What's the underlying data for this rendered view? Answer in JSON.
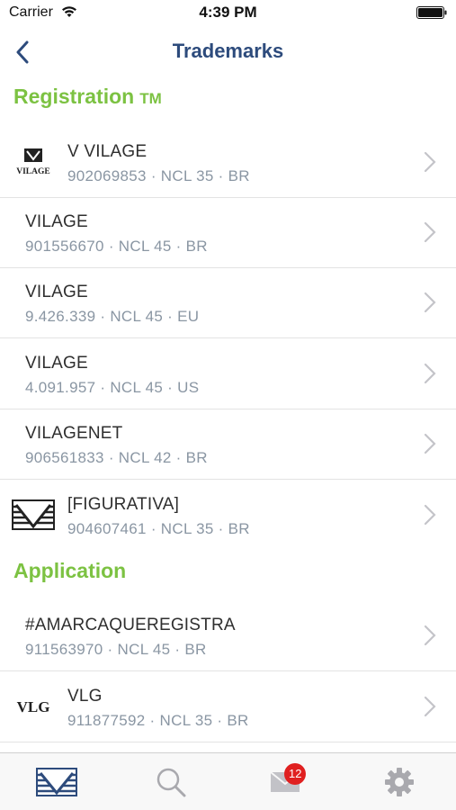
{
  "status_bar": {
    "carrier": "Carrier",
    "time": "4:39 PM"
  },
  "nav": {
    "title": "Trademarks"
  },
  "sections": {
    "registration": {
      "label": "Registration",
      "tm": "TM"
    },
    "application": {
      "label": "Application"
    }
  },
  "registrations": [
    {
      "title": "V VILAGE",
      "subtitle": "902069853 · NCL 35 · BR",
      "logo": "vilage-logo-icon",
      "logo_text": "VILAGE"
    },
    {
      "title": "VILAGE",
      "subtitle": "901556670 · NCL 45 · BR"
    },
    {
      "title": "VILAGE",
      "subtitle": "9.426.339 · NCL 45 · EU"
    },
    {
      "title": "VILAGE",
      "subtitle": "4.091.957 · NCL 45 · US"
    },
    {
      "title": "VILAGENET",
      "subtitle": "906561833 · NCL 42 · BR"
    },
    {
      "title": "[FIGURATIVA]",
      "subtitle": "904607461 · NCL 35 · BR",
      "logo": "figurative-mark-icon"
    }
  ],
  "applications": [
    {
      "title": "#AMARCAQUEREGISTRA",
      "subtitle": "911563970 · NCL 45 · BR"
    },
    {
      "title": "VLG",
      "subtitle": "911877592 · NCL 35 · BR",
      "logo": "vlg-logo-icon",
      "logo_text": "VLG"
    }
  ],
  "tab_bar": {
    "tabs": [
      {
        "icon": "trademark-tab-icon",
        "active": true
      },
      {
        "icon": "search-icon"
      },
      {
        "icon": "mail-icon",
        "badge": "12"
      },
      {
        "icon": "gear-icon"
      }
    ]
  },
  "colors": {
    "accent_green": "#7cc242",
    "nav_blue": "#2d4b7c",
    "badge_red": "#e02020",
    "subtitle_gray": "#8a96a3"
  }
}
